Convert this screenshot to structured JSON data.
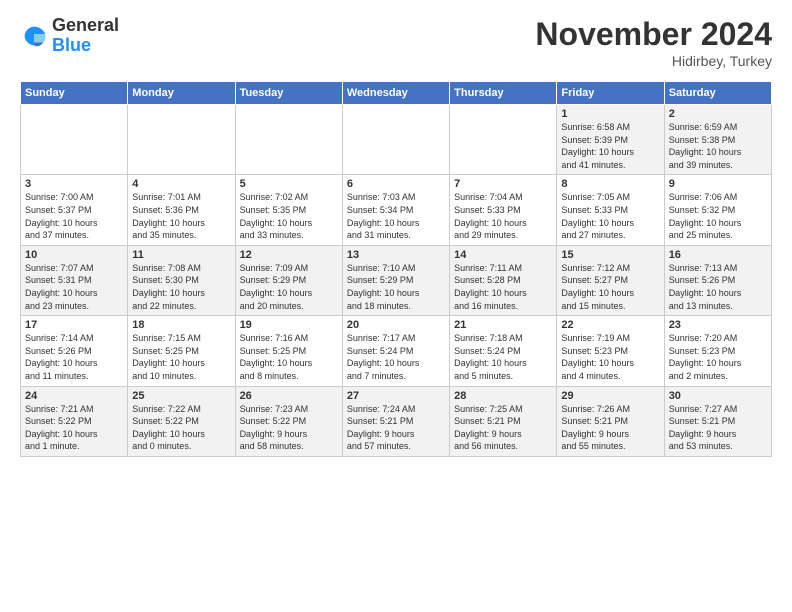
{
  "logo": {
    "general": "General",
    "blue": "Blue"
  },
  "title": "November 2024",
  "subtitle": "Hidirbey, Turkey",
  "days_of_week": [
    "Sunday",
    "Monday",
    "Tuesday",
    "Wednesday",
    "Thursday",
    "Friday",
    "Saturday"
  ],
  "weeks": [
    [
      {
        "day": "",
        "info": ""
      },
      {
        "day": "",
        "info": ""
      },
      {
        "day": "",
        "info": ""
      },
      {
        "day": "",
        "info": ""
      },
      {
        "day": "",
        "info": ""
      },
      {
        "day": "1",
        "info": "Sunrise: 6:58 AM\nSunset: 5:39 PM\nDaylight: 10 hours\nand 41 minutes."
      },
      {
        "day": "2",
        "info": "Sunrise: 6:59 AM\nSunset: 5:38 PM\nDaylight: 10 hours\nand 39 minutes."
      }
    ],
    [
      {
        "day": "3",
        "info": "Sunrise: 7:00 AM\nSunset: 5:37 PM\nDaylight: 10 hours\nand 37 minutes."
      },
      {
        "day": "4",
        "info": "Sunrise: 7:01 AM\nSunset: 5:36 PM\nDaylight: 10 hours\nand 35 minutes."
      },
      {
        "day": "5",
        "info": "Sunrise: 7:02 AM\nSunset: 5:35 PM\nDaylight: 10 hours\nand 33 minutes."
      },
      {
        "day": "6",
        "info": "Sunrise: 7:03 AM\nSunset: 5:34 PM\nDaylight: 10 hours\nand 31 minutes."
      },
      {
        "day": "7",
        "info": "Sunrise: 7:04 AM\nSunset: 5:33 PM\nDaylight: 10 hours\nand 29 minutes."
      },
      {
        "day": "8",
        "info": "Sunrise: 7:05 AM\nSunset: 5:33 PM\nDaylight: 10 hours\nand 27 minutes."
      },
      {
        "day": "9",
        "info": "Sunrise: 7:06 AM\nSunset: 5:32 PM\nDaylight: 10 hours\nand 25 minutes."
      }
    ],
    [
      {
        "day": "10",
        "info": "Sunrise: 7:07 AM\nSunset: 5:31 PM\nDaylight: 10 hours\nand 23 minutes."
      },
      {
        "day": "11",
        "info": "Sunrise: 7:08 AM\nSunset: 5:30 PM\nDaylight: 10 hours\nand 22 minutes."
      },
      {
        "day": "12",
        "info": "Sunrise: 7:09 AM\nSunset: 5:29 PM\nDaylight: 10 hours\nand 20 minutes."
      },
      {
        "day": "13",
        "info": "Sunrise: 7:10 AM\nSunset: 5:29 PM\nDaylight: 10 hours\nand 18 minutes."
      },
      {
        "day": "14",
        "info": "Sunrise: 7:11 AM\nSunset: 5:28 PM\nDaylight: 10 hours\nand 16 minutes."
      },
      {
        "day": "15",
        "info": "Sunrise: 7:12 AM\nSunset: 5:27 PM\nDaylight: 10 hours\nand 15 minutes."
      },
      {
        "day": "16",
        "info": "Sunrise: 7:13 AM\nSunset: 5:26 PM\nDaylight: 10 hours\nand 13 minutes."
      }
    ],
    [
      {
        "day": "17",
        "info": "Sunrise: 7:14 AM\nSunset: 5:26 PM\nDaylight: 10 hours\nand 11 minutes."
      },
      {
        "day": "18",
        "info": "Sunrise: 7:15 AM\nSunset: 5:25 PM\nDaylight: 10 hours\nand 10 minutes."
      },
      {
        "day": "19",
        "info": "Sunrise: 7:16 AM\nSunset: 5:25 PM\nDaylight: 10 hours\nand 8 minutes."
      },
      {
        "day": "20",
        "info": "Sunrise: 7:17 AM\nSunset: 5:24 PM\nDaylight: 10 hours\nand 7 minutes."
      },
      {
        "day": "21",
        "info": "Sunrise: 7:18 AM\nSunset: 5:24 PM\nDaylight: 10 hours\nand 5 minutes."
      },
      {
        "day": "22",
        "info": "Sunrise: 7:19 AM\nSunset: 5:23 PM\nDaylight: 10 hours\nand 4 minutes."
      },
      {
        "day": "23",
        "info": "Sunrise: 7:20 AM\nSunset: 5:23 PM\nDaylight: 10 hours\nand 2 minutes."
      }
    ],
    [
      {
        "day": "24",
        "info": "Sunrise: 7:21 AM\nSunset: 5:22 PM\nDaylight: 10 hours\nand 1 minute."
      },
      {
        "day": "25",
        "info": "Sunrise: 7:22 AM\nSunset: 5:22 PM\nDaylight: 10 hours\nand 0 minutes."
      },
      {
        "day": "26",
        "info": "Sunrise: 7:23 AM\nSunset: 5:22 PM\nDaylight: 9 hours\nand 58 minutes."
      },
      {
        "day": "27",
        "info": "Sunrise: 7:24 AM\nSunset: 5:21 PM\nDaylight: 9 hours\nand 57 minutes."
      },
      {
        "day": "28",
        "info": "Sunrise: 7:25 AM\nSunset: 5:21 PM\nDaylight: 9 hours\nand 56 minutes."
      },
      {
        "day": "29",
        "info": "Sunrise: 7:26 AM\nSunset: 5:21 PM\nDaylight: 9 hours\nand 55 minutes."
      },
      {
        "day": "30",
        "info": "Sunrise: 7:27 AM\nSunset: 5:21 PM\nDaylight: 9 hours\nand 53 minutes."
      }
    ]
  ]
}
